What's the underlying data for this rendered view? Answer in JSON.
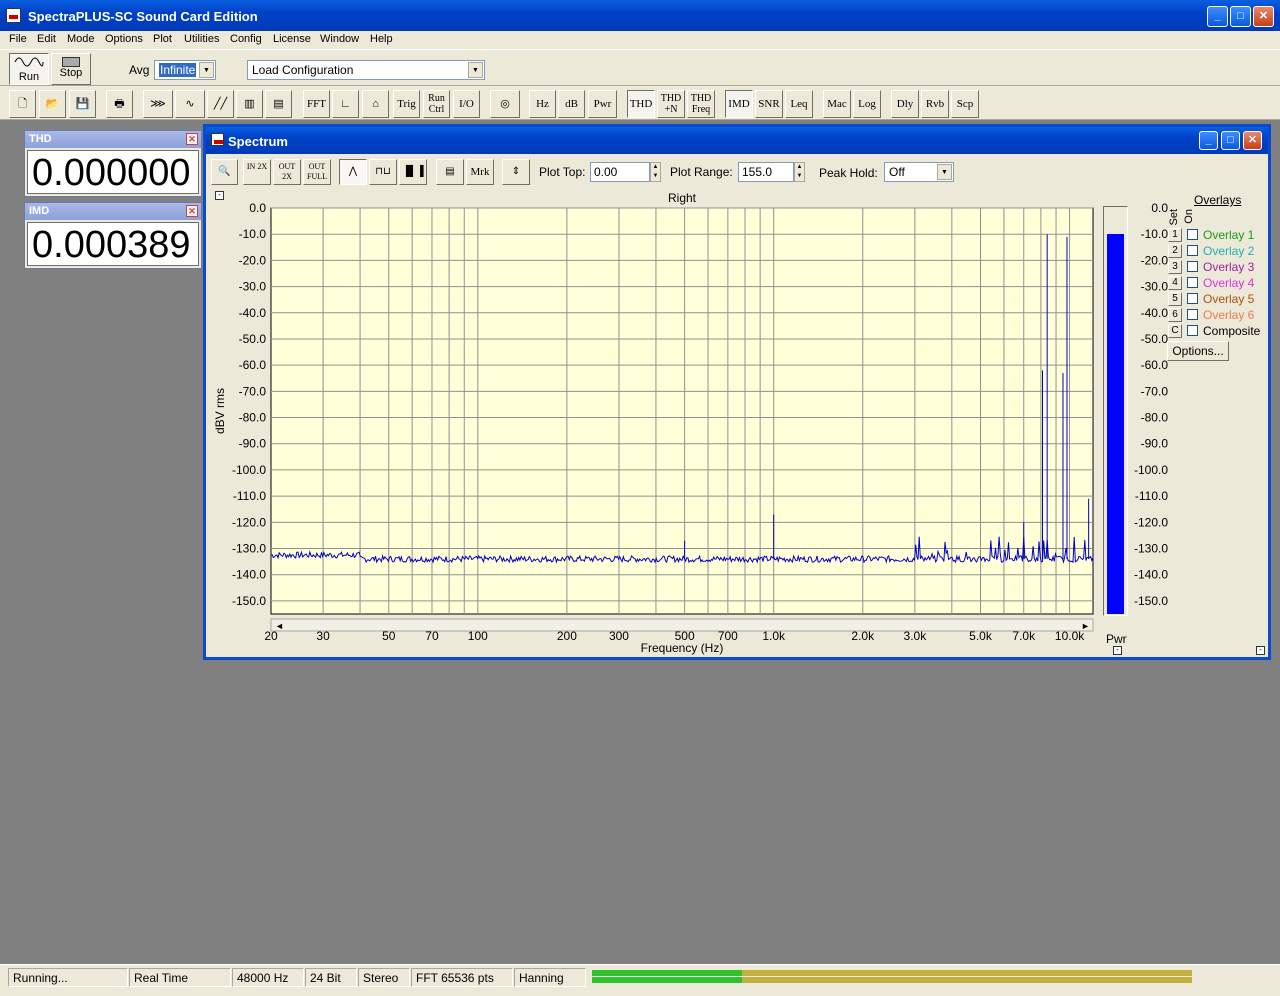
{
  "app": {
    "title": "SpectraPLUS-SC Sound Card Edition"
  },
  "menu": [
    "File",
    "Edit",
    "Mode",
    "Options",
    "Plot",
    "Utilities",
    "Config",
    "License",
    "Window",
    "Help"
  ],
  "toolbar1": {
    "run_label": "Run",
    "stop_label": "Stop",
    "avg_label": "Avg",
    "avg_value": "Infinite",
    "config_value": "Load Configuration"
  },
  "toolbar2": [
    "FFT",
    "Trig",
    "Run Ctrl",
    "I/O",
    "Hz",
    "dB",
    "Pwr",
    "THD",
    "THD +N",
    "THD Freq",
    "IMD",
    "SNR",
    "Leq",
    "Mac",
    "Log",
    "Dly",
    "Rvb",
    "Scp"
  ],
  "meters": [
    {
      "title": "THD",
      "value": "0.000000 %"
    },
    {
      "title": "IMD",
      "value": "0.000389 %"
    }
  ],
  "spectrum": {
    "title": "Spectrum",
    "tb": {
      "in2x": "IN 2X",
      "out2x": "OUT 2X",
      "outfull": "OUT FULL",
      "mrk": "Mrk"
    },
    "plot_top_label": "Plot Top:",
    "plot_top_value": "0.00",
    "plot_range_label": "Plot Range:",
    "plot_range_value": "155.0",
    "peak_hold_label": "Peak Hold:",
    "peak_hold_value": "Off",
    "options_label": "Options...",
    "overlays_header": "Overlays",
    "set_header": "Set",
    "on_header": "On",
    "overlays": [
      {
        "set": "1",
        "label": "Overlay 1",
        "color": "#1a9a1a"
      },
      {
        "set": "2",
        "label": "Overlay 2",
        "color": "#20b0b0"
      },
      {
        "set": "3",
        "label": "Overlay 3",
        "color": "#a020a0"
      },
      {
        "set": "4",
        "label": "Overlay 4",
        "color": "#e030e0"
      },
      {
        "set": "5",
        "label": "Overlay 5",
        "color": "#b05010"
      },
      {
        "set": "6",
        "label": "Overlay 6",
        "color": "#f07850"
      },
      {
        "set": "C",
        "label": "Composite",
        "color": "#000000"
      }
    ],
    "pwr_label": "Pwr"
  },
  "chart_data": {
    "type": "line",
    "title": "Right",
    "xlabel": "Frequency (Hz)",
    "ylabel": "dBV rms",
    "xscale": "log",
    "xlim": [
      20,
      12000
    ],
    "ylim": [
      -155,
      0
    ],
    "x_ticks": [
      20,
      30,
      50,
      70,
      100,
      200,
      300,
      500,
      700,
      1000,
      2000,
      3000,
      5000,
      7000,
      10000
    ],
    "x_tick_labels": [
      "20",
      "30",
      "50",
      "70",
      "100",
      "200",
      "300",
      "500",
      "700",
      "1.0k",
      "2.0k",
      "3.0k",
      "5.0k",
      "7.0k",
      "10.0k"
    ],
    "y_ticks": [
      0,
      -10,
      -20,
      -30,
      -40,
      -50,
      -60,
      -70,
      -80,
      -90,
      -100,
      -110,
      -120,
      -130,
      -140,
      -150
    ],
    "y_tick_labels": [
      "0.0",
      "-10.0",
      "-20.0",
      "-30.0",
      "-40.0",
      "-50.0",
      "-60.0",
      "-70.0",
      "-80.0",
      "-90.0",
      "-100.0",
      "-110.0",
      "-120.0",
      "-130.0",
      "-140.0",
      "-150.0"
    ],
    "series": [
      {
        "values_noise_floor": -134,
        "color": "#0000c8"
      }
    ],
    "peaks": [
      {
        "x": 500,
        "y": -127
      },
      {
        "x": 1000,
        "y": -117
      },
      {
        "x": 7000,
        "y": -120
      },
      {
        "x": 8100,
        "y": -62
      },
      {
        "x": 8400,
        "y": -10
      },
      {
        "x": 9500,
        "y": -63
      },
      {
        "x": 9800,
        "y": -11
      },
      {
        "x": 11600,
        "y": -111
      }
    ],
    "grid": true,
    "pwr_bar": {
      "level": -10,
      "color": "#0000ff"
    }
  },
  "status": {
    "state": "Running...",
    "mode": "Real Time",
    "rate": "48000 Hz",
    "bits": "24 Bit",
    "channels": "Stereo",
    "fft": "FFT 65536 pts",
    "window": "Hanning"
  }
}
